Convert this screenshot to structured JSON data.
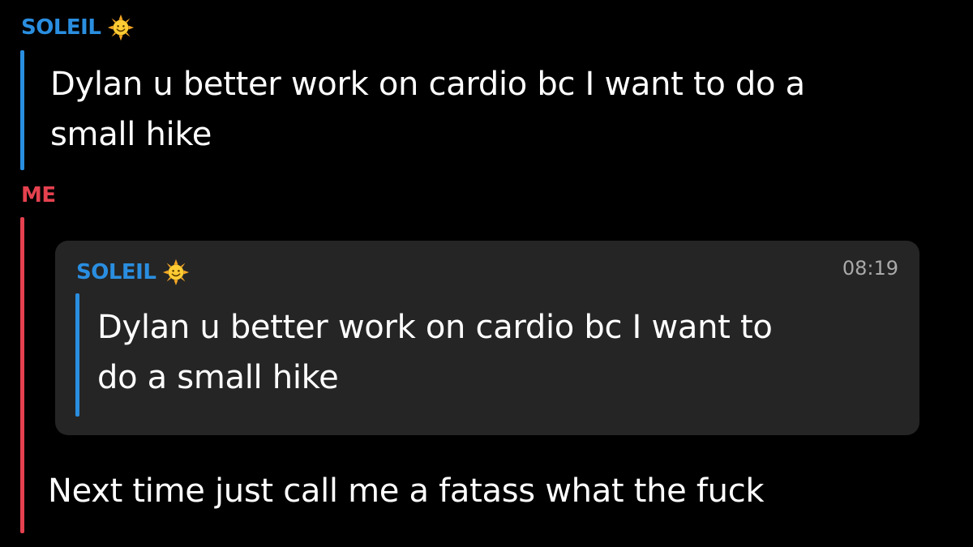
{
  "colors": {
    "soleil": "#2a8ee0",
    "me": "#e5414f",
    "card_bg": "#252525",
    "timestamp": "#a9a9a9"
  },
  "first_message": {
    "sender": "SOLEIL",
    "sender_icon": "sun-face-emoji",
    "lines": [
      "Dylan u better work on cardio bc I want to do a",
      "small hike"
    ]
  },
  "reply": {
    "sender": "ME",
    "quoted": {
      "sender": "SOLEIL",
      "sender_icon": "sun-face-emoji",
      "time": "08:19",
      "lines": [
        "Dylan u better work on cardio bc I want to",
        "do a small hike"
      ]
    },
    "text": "Next time just call me a fatass what the fuck"
  }
}
